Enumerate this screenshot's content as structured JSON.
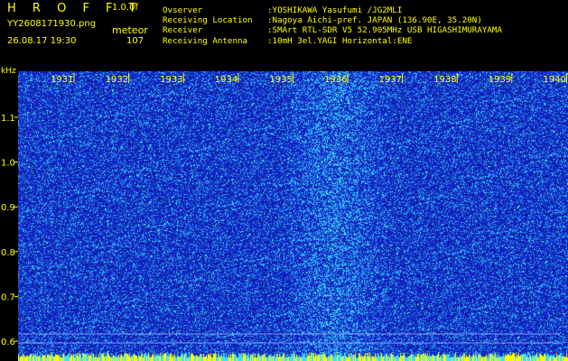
{
  "header": {
    "app_title": "H R O F F T",
    "version": "1.0.0f",
    "file_name": "YY2608171930.png",
    "datetime": "26.08.17 19:30",
    "mode": "meteor",
    "count": "107"
  },
  "info": [
    {
      "label": "Ovserver",
      "value": ":YOSHIKAWA Yasufumi /JG2MLI"
    },
    {
      "label": "Receiving Location",
      "value": ":Nagoya Aichi-pref. JAPAN (136.90E, 35.20N)"
    },
    {
      "label": "Receiver",
      "value": ":SMArt RTL-SDR V5 52.905MHz USB HIGASHIMURAYAMA"
    },
    {
      "label": "Receiving Antenna",
      "value": ":10mH 3el.YAGI Horizontal:ENE"
    }
  ],
  "axis": {
    "unit_label": "kHz",
    "y_ticks": [
      "1.1",
      "1.0",
      "0.9",
      "0.8",
      "0.7",
      "0.6"
    ],
    "x_ticks": [
      "1931",
      "1932",
      "1933",
      "1934",
      "1935",
      "1936",
      "1937",
      "1938",
      "1939",
      "1940"
    ]
  },
  "colors": {
    "text": "#ffff00",
    "background": "#000000",
    "spectrogram_base": "#1a2ab0",
    "noise_dot": "#3cd8ff"
  }
}
